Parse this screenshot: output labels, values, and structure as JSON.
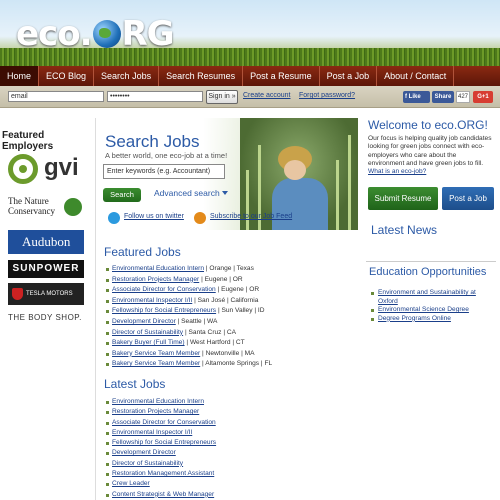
{
  "header": {
    "logo_text_a": "eco.",
    "logo_text_b": "RG"
  },
  "nav": [
    "Home",
    "ECO Blog",
    "Search Jobs",
    "Search Resumes",
    "Post a Resume",
    "Post a Job",
    "About / Contact"
  ],
  "login": {
    "email_value": "email",
    "password_value": "••••••••",
    "signin_label": "Sign in »",
    "create_account": "Create account",
    "forgot_password": "Forgot password?",
    "fb_like": "Like",
    "fb_share": "Share",
    "like_count": "427",
    "gplus": "G+1"
  },
  "left": {
    "heading": "Featured Employers",
    "gvi": "gvi",
    "tnc_line1": "The Nature",
    "tnc_line2": "Conservancy",
    "audubon": "Audubon",
    "sunpower": "SUNPOWER",
    "tesla": "TESLA MOTORS",
    "bodyshop": "THE BODY SHOP."
  },
  "search": {
    "title": "Search Jobs",
    "subtitle": "A better world, one eco-job at a time!",
    "keyword_placeholder": "Enter keywords (e.g. Accountant)",
    "button": "Search",
    "advanced": "Advanced search",
    "twitter": "Follow us on twitter",
    "feed": "Subscribe to our Job Feed"
  },
  "featured": {
    "heading": "Featured Jobs",
    "jobs": [
      {
        "title": "Environmental Education Intern",
        "loc": "| Orange | Texas"
      },
      {
        "title": "Restoration Projects Manager",
        "loc": "| Eugene | OR"
      },
      {
        "title": "Associate Director for Conservation",
        "loc": "| Eugene | OR"
      },
      {
        "title": "Environmental Inspector I/II",
        "loc": "| San José | California"
      },
      {
        "title": "Fellowship for Social Entrepreneurs",
        "loc": "| Sun Valley | ID"
      },
      {
        "title": "Development Director",
        "loc": "| Seattle | WA"
      },
      {
        "title": "Director of Sustainability",
        "loc": "| Santa Cruz | CA"
      },
      {
        "title": "Bakery Buyer (Full Time)",
        "loc": "| West Hartford | CT"
      },
      {
        "title": "Bakery Service Team Member",
        "loc": "| Newtonville | MA"
      },
      {
        "title": "Bakery Service Team Member",
        "loc": "| Altamonte Springs | FL"
      }
    ]
  },
  "latest": {
    "heading": "Latest Jobs",
    "jobs": [
      "Environmental Education Intern",
      "Restoration Projects Manager",
      "Associate Director for Conservation",
      "Environmental Inspector I/II",
      "Fellowship for Social Entrepreneurs",
      "Development Director",
      "Director of Sustainability",
      "Restoration Management Assistant",
      "Crew Leader",
      "Content Strategist & Web Manager"
    ]
  },
  "right": {
    "welcome": "Welcome to eco.ORG!",
    "blurb": "Our focus is helping quality job candidates looking for green jobs connect with eco-employers who care about the environment and have green jobs to fill.",
    "what_link": "What is an eco-job?",
    "submit_resume": "Submit Resume",
    "post_job": "Post a Job",
    "latest_news": "Latest News",
    "edu_heading": "Education Opportunities",
    "edu_items": [
      "Environment and Sustainability at Oxford",
      "Environmental Science Degree",
      "Degree Programs Online"
    ]
  },
  "colors": {
    "nav_bg": "#6e1e0c",
    "link_blue": "#2c5aa6",
    "green_button": "#2e7a25",
    "blue_button": "#2a62a8"
  }
}
